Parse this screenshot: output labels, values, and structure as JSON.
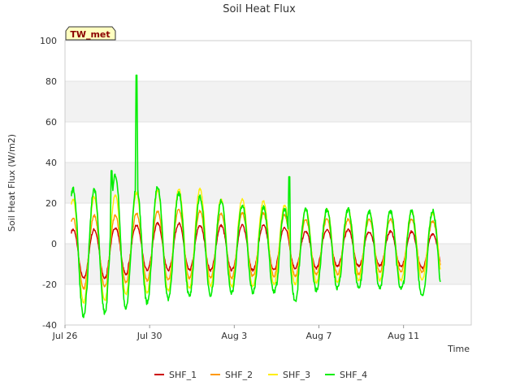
{
  "chart_data": {
    "type": "line",
    "title": "Soil Heat Flux",
    "xlabel": "Time",
    "ylabel": "Soil Heat Flux (W/m2)",
    "badge": "TW_met",
    "xlim": [
      0,
      19.2
    ],
    "ylim": [
      -40,
      100
    ],
    "yticks": [
      -40,
      -20,
      0,
      20,
      40,
      60,
      80,
      100
    ],
    "xticks": [
      {
        "at": 0,
        "label": "Jul 26"
      },
      {
        "at": 4,
        "label": "Jul 30"
      },
      {
        "at": 8,
        "label": "Aug 3"
      },
      {
        "at": 12,
        "label": "Aug 7"
      },
      {
        "at": 16,
        "label": "Aug 11"
      }
    ],
    "grid": true,
    "legend_position": "bottom",
    "days": [
      "Jul 26",
      "Jul 27",
      "Jul 28",
      "Jul 29",
      "Jul 30",
      "Jul 31",
      "Aug 1",
      "Aug 2",
      "Aug 3",
      "Aug 4",
      "Aug 5",
      "Aug 6",
      "Aug 7",
      "Aug 8",
      "Aug 9",
      "Aug 10",
      "Aug 11",
      "Aug 12"
    ],
    "series": [
      {
        "name": "SHF_1",
        "color": "#cc0000",
        "daily_max": [
          7,
          7,
          8,
          9,
          10,
          10,
          9,
          9,
          9,
          9,
          8,
          6,
          7,
          7,
          6,
          6,
          6,
          5
        ],
        "daily_min": [
          -17,
          -17,
          -15,
          -13,
          -13,
          -13,
          -13,
          -13,
          -13,
          -13,
          -12,
          -12,
          -11,
          -11,
          -11,
          -11,
          -12,
          -12
        ]
      },
      {
        "name": "SHF_2",
        "color": "#ff9900",
        "daily_max": [
          13,
          14,
          14,
          15,
          16,
          17,
          16,
          15,
          15,
          15,
          14,
          12,
          12,
          12,
          12,
          12,
          12,
          11
        ],
        "daily_min": [
          -22,
          -21,
          -19,
          -18,
          -18,
          -17,
          -17,
          -17,
          -16,
          -16,
          -16,
          -15,
          -15,
          -15,
          -14,
          -14,
          -14,
          -15
        ]
      },
      {
        "name": "SHF_3",
        "color": "#ffee00",
        "daily_max": [
          22,
          23,
          24,
          25,
          26,
          27,
          27,
          22,
          22,
          21,
          19,
          17,
          17,
          17,
          16,
          16,
          16,
          15
        ],
        "daily_min": [
          -29,
          -28,
          -25,
          -24,
          -23,
          -22,
          -21,
          -21,
          -21,
          -20,
          -20,
          -19,
          -19,
          -18,
          -18,
          -18,
          -18,
          -18
        ]
      },
      {
        "name": "SHF_4",
        "color": "#00ee00",
        "daily_max": [
          27,
          27,
          34,
          28,
          28,
          25,
          23,
          21,
          19,
          18,
          17,
          17,
          17,
          17,
          16,
          16,
          16,
          16
        ],
        "daily_min": [
          -36,
          -34,
          -32,
          -29,
          -27,
          -26,
          -25,
          -24,
          -24,
          -24,
          -28,
          -23,
          -22,
          -22,
          -22,
          -22,
          -26,
          -27
        ],
        "spikes": [
          {
            "x": 3.38,
            "y": 83
          },
          {
            "x": 10.6,
            "y": 33
          },
          {
            "x": 2.2,
            "y": 36
          }
        ]
      }
    ]
  }
}
